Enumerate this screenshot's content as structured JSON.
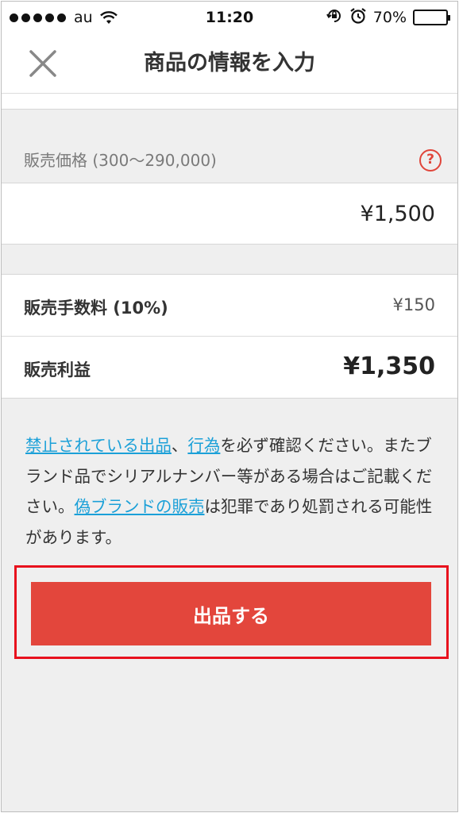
{
  "status_bar": {
    "carrier": "au",
    "time": "11:20",
    "battery": "70%"
  },
  "nav": {
    "title": "商品の情報を入力"
  },
  "price": {
    "label": "販売価格 (300〜290,000)",
    "value": "¥1,500"
  },
  "fees": {
    "commission_label": "販売手数料 (10%)",
    "commission_value": "¥150",
    "profit_label": "販売利益",
    "profit_value": "¥1,350"
  },
  "notice": {
    "link_prohibited": "禁止されている出品",
    "separator": "、",
    "link_acts": "行為",
    "text1": "を必ず確認ください。またブランド品でシリアルナンバー等がある場合はご記載ください。",
    "link_counterfeit": "偽ブランドの販売",
    "text2": "は犯罪であり処罰される可能性があります。"
  },
  "submit": {
    "label": "出品する"
  },
  "colors": {
    "accent": "#e3463c",
    "link": "#1ba0d8",
    "highlight": "#e8111d"
  },
  "icons": [
    "signal-dots-icon",
    "wifi-icon",
    "rotation-lock-icon",
    "alarm-icon",
    "battery-icon",
    "close-icon",
    "help-icon"
  ]
}
